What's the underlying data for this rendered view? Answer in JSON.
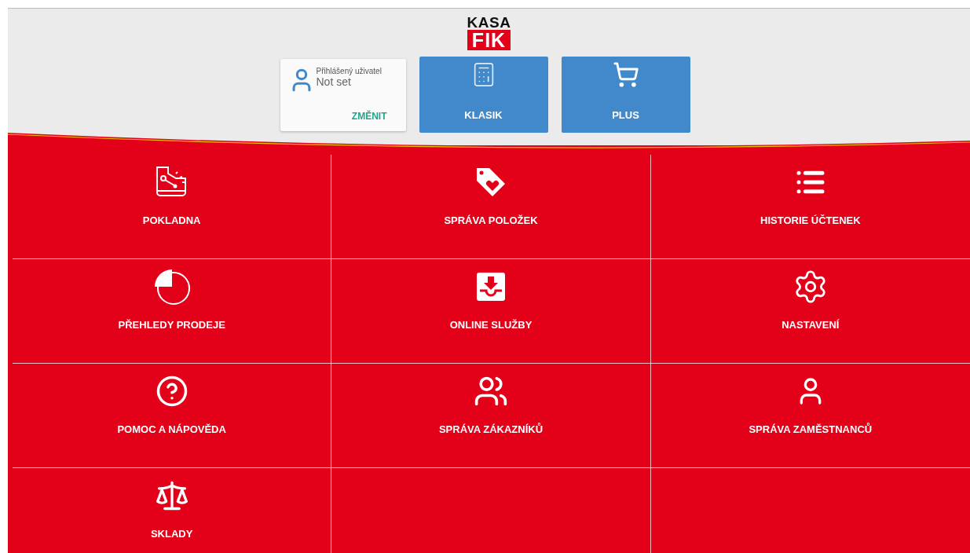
{
  "logo": {
    "top": "KASA",
    "bottom": "FIK"
  },
  "user_card": {
    "label": "Přihlášený uživatel",
    "value": "Not set",
    "action": "ZMĚNIT"
  },
  "modes": [
    {
      "label": "KLASIK"
    },
    {
      "label": "PLUS"
    }
  ],
  "tiles": [
    {
      "label": "POKLADNA"
    },
    {
      "label": "SPRÁVA POLOŽEK"
    },
    {
      "label": "HISTORIE ÚČTENEK"
    },
    {
      "label": "PŘEHLEDY PRODEJE"
    },
    {
      "label": "ONLINE SLUŽBY"
    },
    {
      "label": "NASTAVENÍ"
    },
    {
      "label": "POMOC A NÁPOVĚDA"
    },
    {
      "label": "SPRÁVA ZÁKAZNÍKŮ"
    },
    {
      "label": "SPRÁVA ZAMĚSTNANCŮ"
    },
    {
      "label": "SKLADY"
    }
  ]
}
